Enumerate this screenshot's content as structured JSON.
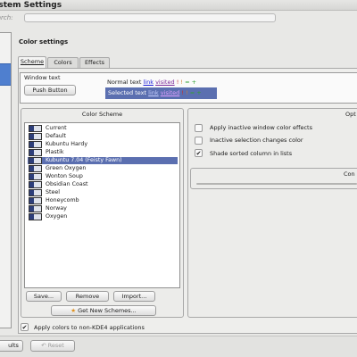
{
  "window": {
    "title": "System Settings"
  },
  "search": {
    "label": "Search:",
    "value": ""
  },
  "panel": {
    "title": "Color settings",
    "tabs": [
      {
        "label": "Scheme",
        "active": true
      },
      {
        "label": "Colors",
        "active": false
      },
      {
        "label": "Effects",
        "active": false
      }
    ]
  },
  "preview": {
    "window_text_label": "Window text",
    "push_button_label": "Push Button",
    "normal": {
      "text": "Normal text",
      "link": "link",
      "visited": "visited",
      "negative": "!",
      "neutral": "!",
      "active": "=",
      "positive": "+"
    },
    "selected": {
      "text": "Selected text",
      "link": "link",
      "visited": "visited",
      "negative": "!",
      "neutral": "!",
      "active": "=",
      "positive": "+"
    }
  },
  "color_scheme": {
    "title": "Color Scheme",
    "items": [
      "Current",
      "Default",
      "Kubuntu Hardy",
      "Plastik",
      "Kubuntu 7.04 (Feisty Fawn)",
      "Green Oxygen",
      "Wonton Soup",
      "Obsidian Coast",
      "Steel",
      "Honeycomb",
      "Norway",
      "Oxygen"
    ],
    "selected_index": 4,
    "buttons": {
      "save": "Save...",
      "remove": "Remove",
      "import": "Import...",
      "get_new": "Get New Schemes..."
    }
  },
  "options": {
    "title": "Opt",
    "items": [
      {
        "label": "Apply inactive window color effects",
        "checked": false
      },
      {
        "label": "Inactive selection changes color",
        "checked": false
      },
      {
        "label": "Shade sorted column in lists",
        "checked": true
      }
    ],
    "contrast_title": "Con"
  },
  "apply_non_kde": {
    "label": "Apply colors to non-KDE4 applications",
    "checked": true
  },
  "footer": {
    "defaults_label": "ults",
    "reset_label": "Reset"
  },
  "colors": {
    "selection": "#5b6fb0",
    "link": "#1a1ad8",
    "visited": "#7a2a9a"
  }
}
